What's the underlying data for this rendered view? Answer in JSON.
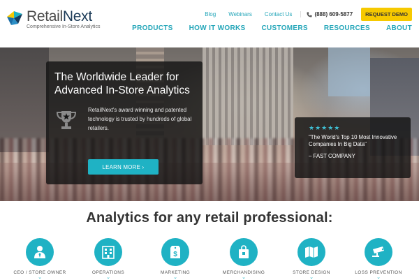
{
  "brand": {
    "name_prefix": "Retail",
    "name_suffix": "Next",
    "tagline": "Comprehensive In-Store Analytics"
  },
  "top_links": [
    {
      "label": "Blog"
    },
    {
      "label": "Webinars"
    },
    {
      "label": "Contact Us"
    }
  ],
  "phone": "(888) 609-5877",
  "request_demo": "REQUEST DEMO",
  "nav": [
    {
      "label": "PRODUCTS"
    },
    {
      "label": "HOW IT WORKS"
    },
    {
      "label": "CUSTOMERS"
    },
    {
      "label": "RESOURCES"
    },
    {
      "label": "ABOUT"
    }
  ],
  "hero": {
    "title": "The Worldwide Leader for Advanced In-Store Analytics",
    "body": "RetailNext's award winning and patented technology is trusted by hundreds of global retailers.",
    "cta": "LEARN MORE ›"
  },
  "testimonial": {
    "stars": "★★★★★",
    "quote": "\"The World's Top 10 Most Innovative Companies In Big Data\"",
    "source": "– FAST COMPANY"
  },
  "analytics": {
    "heading": "Analytics for any retail professional:",
    "roles": [
      {
        "label": "CEO / STORE OWNER",
        "icon": "person-icon"
      },
      {
        "label": "OPERATIONS",
        "icon": "building-icon"
      },
      {
        "label": "MARKETING",
        "icon": "dollar-tag-icon"
      },
      {
        "label": "MERCHANDISING",
        "icon": "shopping-bag-icon"
      },
      {
        "label": "STORE DESIGN",
        "icon": "map-icon"
      },
      {
        "label": "LOSS PREVENTION",
        "icon": "camera-icon"
      }
    ]
  },
  "colors": {
    "accent": "#1fb2c4",
    "demo_button": "#f6c900",
    "overlay": "#141414"
  }
}
